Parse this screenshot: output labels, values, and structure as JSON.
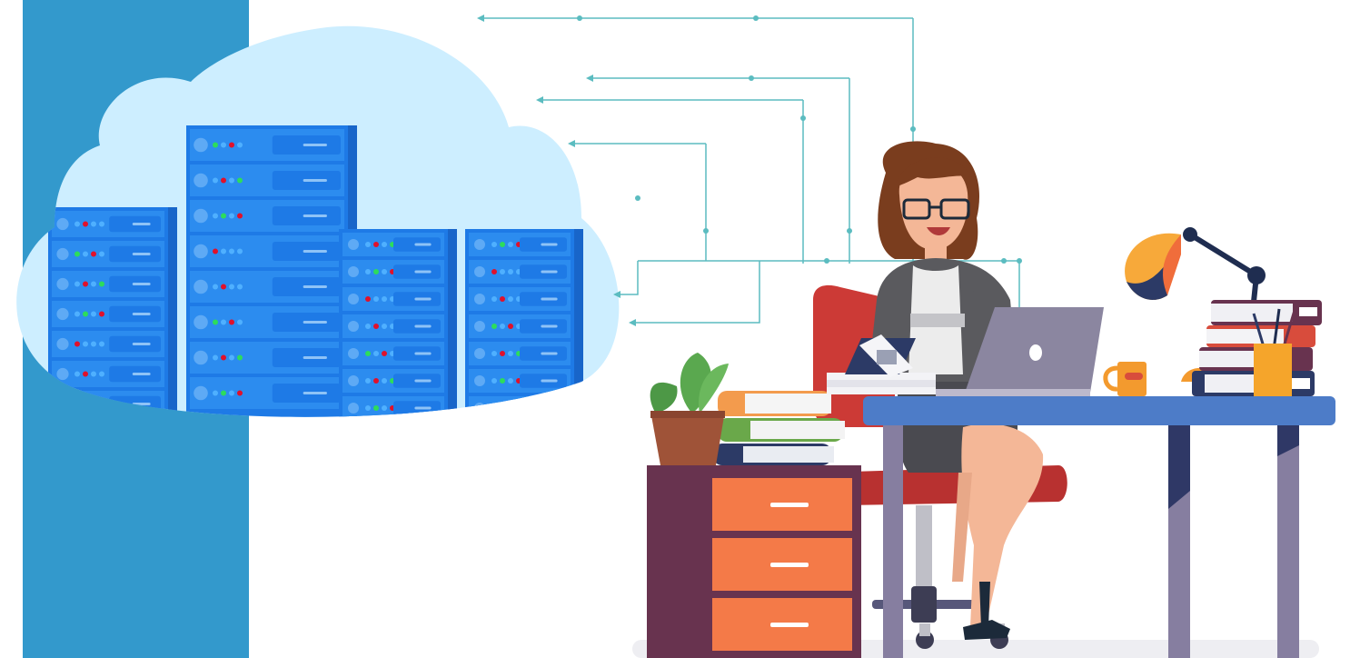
{
  "illustration": {
    "colors": {
      "side_band": "#3399cc",
      "cloud": "#cdeeff",
      "server_face": "#2c8cef",
      "server_slot": "#1e7ae6",
      "connector_line": "#5bbcc0",
      "desk_top": "#4d7cc8",
      "desk_legs": "#867ea0",
      "drawer_cabinet": "#68334f",
      "drawer_front": "#f47a48",
      "chair": "#cc3a36",
      "laptop": "#8b86a0",
      "lamp_shade": "#f7a93a",
      "lamp_arm": "#1f2d50",
      "plant_pot": "#9f5338",
      "plant_leaves": "#5aa84f",
      "blazer": "#5a5a5e",
      "hair": "#7a3d1e",
      "skin": "#f4b797",
      "mug": "#f39a2e",
      "pen_cup": "#f5a52b"
    },
    "icons": [
      "cloud-icon",
      "server-rack-icon",
      "laptop-icon",
      "desk-lamp-icon",
      "potted-plant-icon",
      "calculator-icon",
      "coffee-mug-icon",
      "pen-cup-icon",
      "book-stack-icon",
      "office-chair-icon",
      "drawer-cabinet-icon"
    ]
  }
}
